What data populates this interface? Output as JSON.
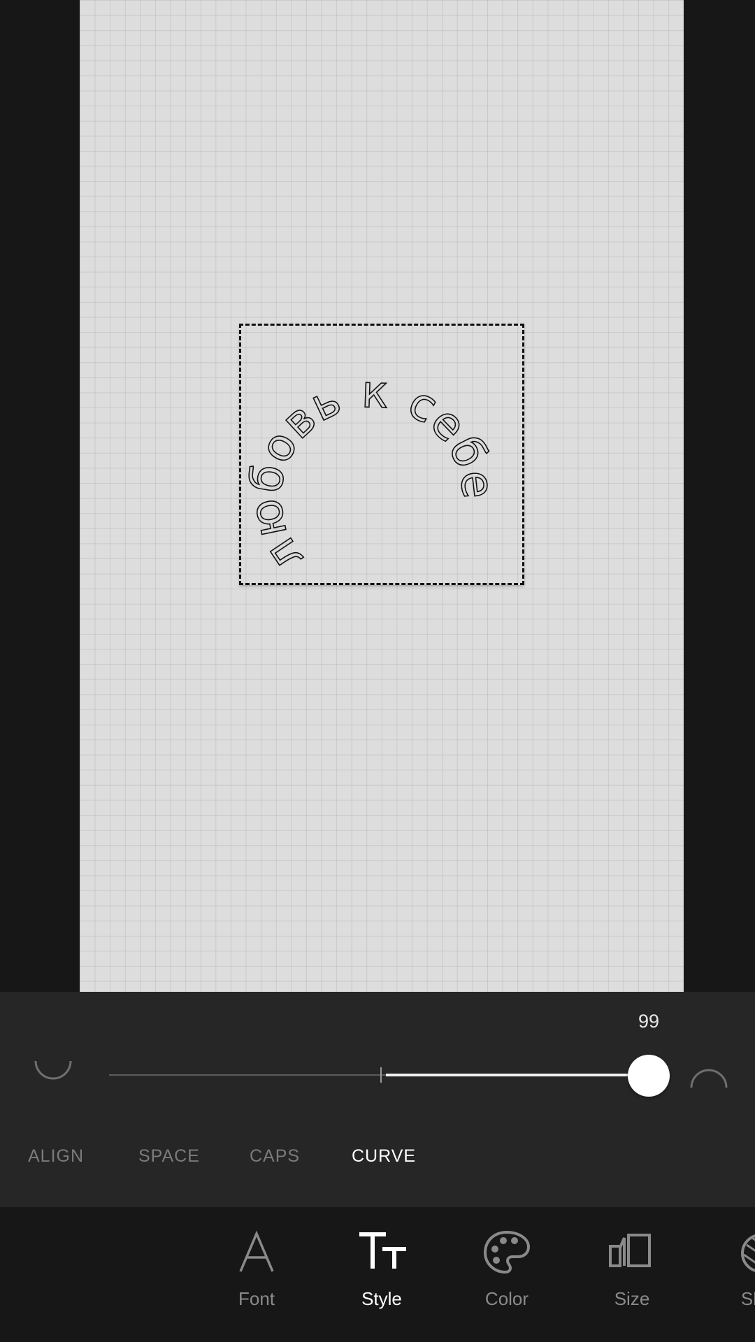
{
  "canvas": {
    "curved_text": "любовь к себе"
  },
  "curve_control": {
    "value": "99"
  },
  "subtabs": [
    {
      "label": "ALIGN"
    },
    {
      "label": "SPACE"
    },
    {
      "label": "CAPS"
    },
    {
      "label": "CURVE"
    }
  ],
  "active_subtab": "CURVE",
  "tools": [
    {
      "label": "Font",
      "icon": "font-icon"
    },
    {
      "label": "Style",
      "icon": "style-icon"
    },
    {
      "label": "Color",
      "icon": "palette-icon"
    },
    {
      "label": "Size",
      "icon": "size-icon"
    },
    {
      "label": "Sha",
      "icon": "shape-icon"
    }
  ],
  "active_tool": "Style",
  "colors": {
    "canvas_background": "#dddddd",
    "panel_background": "#262626",
    "toolbar_background": "#171717",
    "active_text": "#ffffff",
    "inactive_text": "#7b7b7b"
  }
}
